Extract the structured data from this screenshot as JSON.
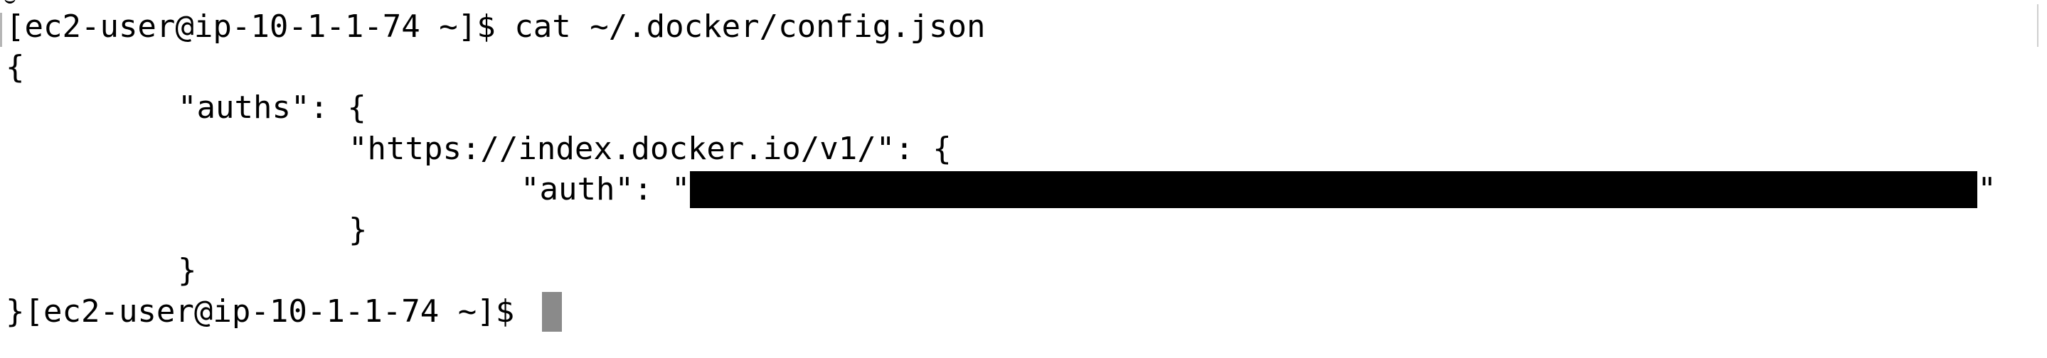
{
  "terminal": {
    "line1": {
      "prompt": "[ec2-user@ip-10-1-1-74 ~]$ ",
      "command": "cat ~/.docker/config.json"
    },
    "line2": "{",
    "line3": "\"auths\": {",
    "line4": "\"https://index.docker.io/v1/\": {",
    "line5": {
      "prefix": "\"auth\": \"",
      "suffix": "\""
    },
    "line6": "}",
    "line7": "}",
    "line8": {
      "text": "}[ec2-user@ip-10-1-1-74 ~]$ "
    }
  }
}
